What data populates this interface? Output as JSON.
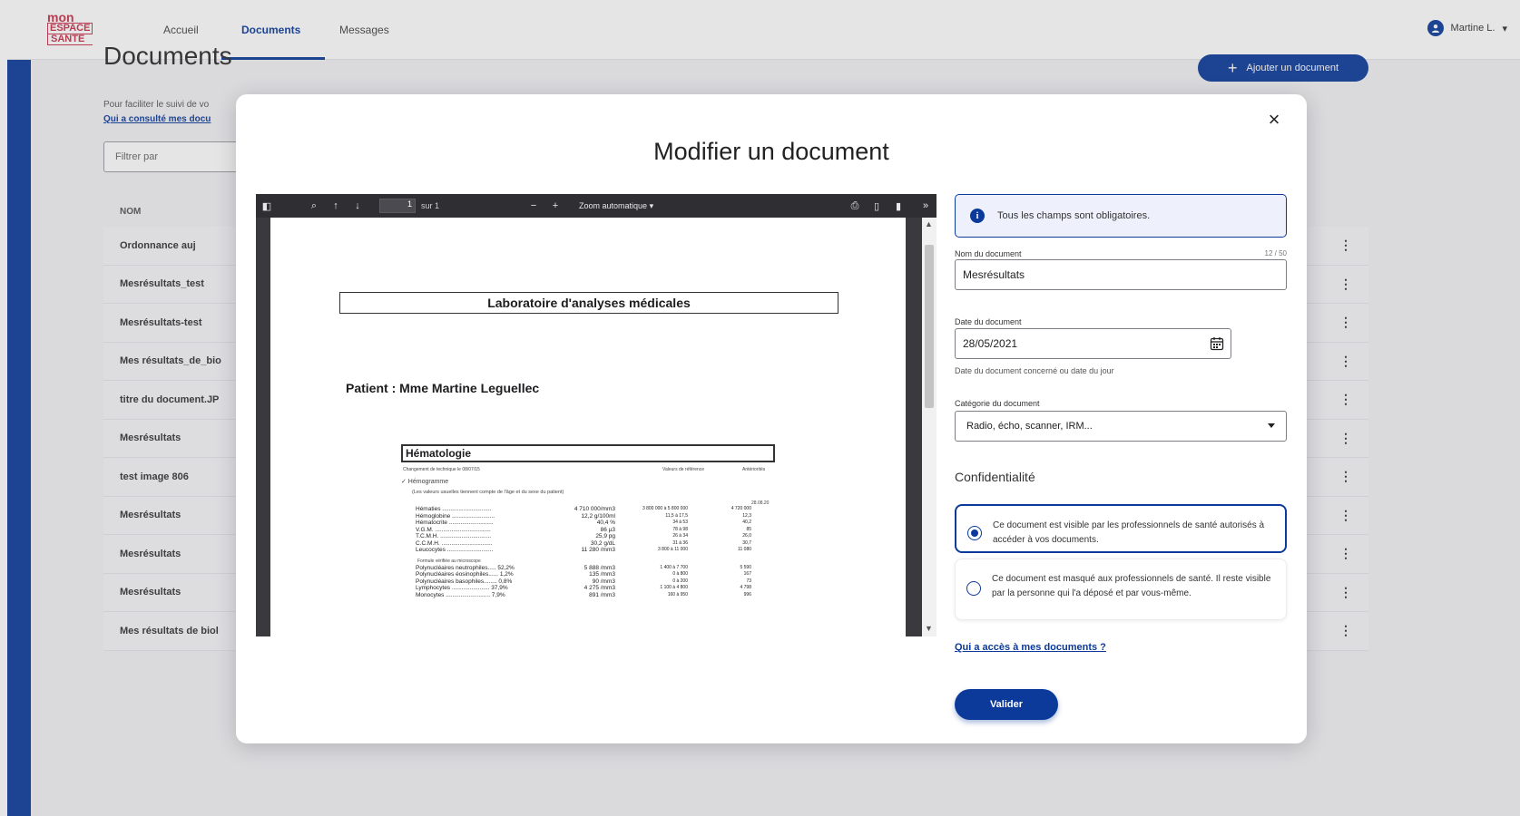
{
  "header": {
    "logo": {
      "line1": "mon",
      "line2": "ESPACE",
      "line3": "SANTE"
    },
    "nav": [
      {
        "label": "Accueil",
        "active": false
      },
      {
        "label": "Documents",
        "active": true
      },
      {
        "label": "Messages",
        "active": false
      }
    ],
    "user_name": "Martine L."
  },
  "page": {
    "title": "Documents",
    "add_button": "Ajouter un document",
    "help_text": "Pour faciliter le suivi de vo",
    "help_link": "Qui a consulté mes docu",
    "filter_placeholder": "Filtrer par",
    "list_header": "NOM",
    "documents": [
      "Ordonnance auj",
      "Mesrésultats_test",
      "Mesrésultats-test",
      "Mes résultats_de_bio",
      "titre du document.JP",
      "Mesrésultats",
      "test image 806",
      "Mesrésultats",
      "Mesrésultats",
      "Mesrésultats",
      "Mes résultats de biol"
    ],
    "row_menu_icon": "⋮"
  },
  "modal": {
    "close_icon": "×",
    "title": "Modifier un document",
    "pdf": {
      "page_number": "1",
      "page_of": "sur 1",
      "zoom": "Zoom automatique",
      "doc": {
        "lab_title": "Laboratoire d'analyses médicales",
        "patient": "Patient : Mme Martine Leguellec",
        "section": "Hématologie",
        "sub1": "Changement de technique le 08/07/15",
        "sub1_right1": "Valeurs de référence",
        "sub1_right2": "Antériorités",
        "group": "✓ Hémogramme",
        "group_note": "(Les valeurs usuelles tiennent compte de l'âge et du sexe du patient)",
        "col_date": "28.08.20",
        "formula_note": "Formule vérifiée au microscope",
        "rows": [
          {
            "name": "Hématies ..............................",
            "value": "4 710 000/mm3",
            "ref": "3 800 000 à 5 800 000",
            "prev": "4 720 000"
          },
          {
            "name": "Hémoglobine ..........................",
            "value": "12,2 g/100ml",
            "ref": "11,5 à 17,5",
            "prev": "12,3"
          },
          {
            "name": "Hématocrite ...........................",
            "value": "40,4 %",
            "ref": "34 à 53",
            "prev": "40,2"
          },
          {
            "name": "V.G.M. ..................................",
            "value": "86 µ3",
            "ref": "78 à 98",
            "prev": "85"
          },
          {
            "name": "T.C.M.H. ...............................",
            "value": "25,9 pg",
            "ref": "26 à 34",
            "prev": "26,0"
          },
          {
            "name": "C.C.M.H. ...............................",
            "value": "30,2 g/dL",
            "ref": "31 à 36",
            "prev": "30,7"
          },
          {
            "name": "Leucocytes ............................",
            "value": "11 280 /mm3",
            "ref": "3 800 à 11 000",
            "prev": "11 080"
          },
          {
            "name": "Polynucléaires neutrophiles..... 52,2%",
            "value": "5 888 /mm3",
            "ref": "1 400 à 7 700",
            "prev": "5 590"
          },
          {
            "name": "Polynucléaires éosinophiles...... 1,2%",
            "value": "135 /mm3",
            "ref": "0 à 800",
            "prev": "167"
          },
          {
            "name": "Polynucléaires basophiles........ 0,8%",
            "value": "90 /mm3",
            "ref": "0 à 200",
            "prev": "73"
          },
          {
            "name": "Lymphocytes ....................... 37,9%",
            "value": "4 275 /mm3",
            "ref": "1 100 à 4 800",
            "prev": "4 798"
          },
          {
            "name": "Monocytes ........................... 7,9%",
            "value": "891 /mm3",
            "ref": "160 à 950",
            "prev": "996"
          }
        ]
      }
    },
    "form": {
      "info": "Tous les champs sont obligatoires.",
      "name_label": "Nom du document",
      "name_counter": "12 / 50",
      "name_value": "Mesrésultats",
      "date_label": "Date du document",
      "date_value": "28/05/2021",
      "date_hint": "Date du document concerné ou date du jour",
      "category_label": "Catégorie du document",
      "category_value": "Radio, écho, scanner, IRM...",
      "confidentiality_title": "Confidentialité",
      "option_visible": "Ce document est visible par les professionnels de santé autorisés à accéder à vos documents.",
      "option_hidden": "Ce document est masqué aux professionnels de santé. Il reste visible par la personne qui l'a déposé et par vous-même.",
      "access_link": "Qui a accès à mes documents ?",
      "submit": "Valider"
    }
  }
}
